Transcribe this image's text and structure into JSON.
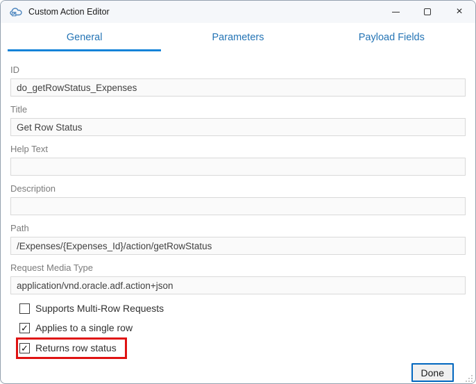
{
  "window": {
    "title": "Custom Action Editor",
    "controls": [
      {
        "name": "minimize"
      },
      {
        "name": "maximize"
      },
      {
        "name": "close",
        "glyph": "×"
      }
    ],
    "app_icon": "cloud-action-icon"
  },
  "tabs": [
    {
      "label": "General",
      "active": true
    },
    {
      "label": "Parameters",
      "active": false
    },
    {
      "label": "Payload Fields",
      "active": false
    }
  ],
  "fields": [
    {
      "label": "ID",
      "value": "do_getRowStatus_Expenses"
    },
    {
      "label": "Title",
      "value": "Get Row Status"
    },
    {
      "label": "Help Text",
      "value": ""
    },
    {
      "label": "Description",
      "value": ""
    },
    {
      "label": "Path",
      "value": "/Expenses/{Expenses_Id}/action/getRowStatus"
    },
    {
      "label": "Request Media Type",
      "value": "application/vnd.oracle.adf.action+json"
    }
  ],
  "checkboxes": [
    {
      "label": "Supports Multi-Row Requests",
      "checked": false,
      "mark": "",
      "highlighted": false
    },
    {
      "label": "Applies to a single row",
      "checked": true,
      "mark": "✓",
      "highlighted": false
    },
    {
      "label": "Returns row status",
      "checked": true,
      "mark": "✓",
      "highlighted": true
    }
  ],
  "footer": {
    "done_label": "Done"
  },
  "colors": {
    "tab_text": "#2474b5",
    "tab_underline": "#1483d8",
    "highlight_red": "#df1212",
    "button_border": "#0066bf",
    "input_border": "#d9d9d9",
    "input_bg": "#fafafa",
    "label_gray": "#7b7b7b",
    "titlebar_bg": "#f5f7fa"
  }
}
